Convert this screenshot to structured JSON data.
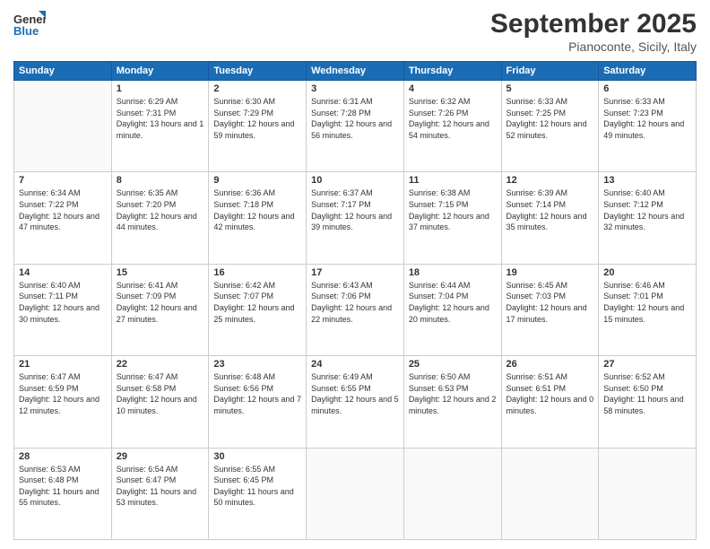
{
  "header": {
    "logo_line1": "General",
    "logo_line2": "Blue",
    "month_title": "September 2025",
    "location": "Pianoconte, Sicily, Italy"
  },
  "weekdays": [
    "Sunday",
    "Monday",
    "Tuesday",
    "Wednesday",
    "Thursday",
    "Friday",
    "Saturday"
  ],
  "weeks": [
    [
      {
        "day": "",
        "sunrise": "",
        "sunset": "",
        "daylight": ""
      },
      {
        "day": "1",
        "sunrise": "Sunrise: 6:29 AM",
        "sunset": "Sunset: 7:31 PM",
        "daylight": "Daylight: 13 hours and 1 minute."
      },
      {
        "day": "2",
        "sunrise": "Sunrise: 6:30 AM",
        "sunset": "Sunset: 7:29 PM",
        "daylight": "Daylight: 12 hours and 59 minutes."
      },
      {
        "day": "3",
        "sunrise": "Sunrise: 6:31 AM",
        "sunset": "Sunset: 7:28 PM",
        "daylight": "Daylight: 12 hours and 56 minutes."
      },
      {
        "day": "4",
        "sunrise": "Sunrise: 6:32 AM",
        "sunset": "Sunset: 7:26 PM",
        "daylight": "Daylight: 12 hours and 54 minutes."
      },
      {
        "day": "5",
        "sunrise": "Sunrise: 6:33 AM",
        "sunset": "Sunset: 7:25 PM",
        "daylight": "Daylight: 12 hours and 52 minutes."
      },
      {
        "day": "6",
        "sunrise": "Sunrise: 6:33 AM",
        "sunset": "Sunset: 7:23 PM",
        "daylight": "Daylight: 12 hours and 49 minutes."
      }
    ],
    [
      {
        "day": "7",
        "sunrise": "Sunrise: 6:34 AM",
        "sunset": "Sunset: 7:22 PM",
        "daylight": "Daylight: 12 hours and 47 minutes."
      },
      {
        "day": "8",
        "sunrise": "Sunrise: 6:35 AM",
        "sunset": "Sunset: 7:20 PM",
        "daylight": "Daylight: 12 hours and 44 minutes."
      },
      {
        "day": "9",
        "sunrise": "Sunrise: 6:36 AM",
        "sunset": "Sunset: 7:18 PM",
        "daylight": "Daylight: 12 hours and 42 minutes."
      },
      {
        "day": "10",
        "sunrise": "Sunrise: 6:37 AM",
        "sunset": "Sunset: 7:17 PM",
        "daylight": "Daylight: 12 hours and 39 minutes."
      },
      {
        "day": "11",
        "sunrise": "Sunrise: 6:38 AM",
        "sunset": "Sunset: 7:15 PM",
        "daylight": "Daylight: 12 hours and 37 minutes."
      },
      {
        "day": "12",
        "sunrise": "Sunrise: 6:39 AM",
        "sunset": "Sunset: 7:14 PM",
        "daylight": "Daylight: 12 hours and 35 minutes."
      },
      {
        "day": "13",
        "sunrise": "Sunrise: 6:40 AM",
        "sunset": "Sunset: 7:12 PM",
        "daylight": "Daylight: 12 hours and 32 minutes."
      }
    ],
    [
      {
        "day": "14",
        "sunrise": "Sunrise: 6:40 AM",
        "sunset": "Sunset: 7:11 PM",
        "daylight": "Daylight: 12 hours and 30 minutes."
      },
      {
        "day": "15",
        "sunrise": "Sunrise: 6:41 AM",
        "sunset": "Sunset: 7:09 PM",
        "daylight": "Daylight: 12 hours and 27 minutes."
      },
      {
        "day": "16",
        "sunrise": "Sunrise: 6:42 AM",
        "sunset": "Sunset: 7:07 PM",
        "daylight": "Daylight: 12 hours and 25 minutes."
      },
      {
        "day": "17",
        "sunrise": "Sunrise: 6:43 AM",
        "sunset": "Sunset: 7:06 PM",
        "daylight": "Daylight: 12 hours and 22 minutes."
      },
      {
        "day": "18",
        "sunrise": "Sunrise: 6:44 AM",
        "sunset": "Sunset: 7:04 PM",
        "daylight": "Daylight: 12 hours and 20 minutes."
      },
      {
        "day": "19",
        "sunrise": "Sunrise: 6:45 AM",
        "sunset": "Sunset: 7:03 PM",
        "daylight": "Daylight: 12 hours and 17 minutes."
      },
      {
        "day": "20",
        "sunrise": "Sunrise: 6:46 AM",
        "sunset": "Sunset: 7:01 PM",
        "daylight": "Daylight: 12 hours and 15 minutes."
      }
    ],
    [
      {
        "day": "21",
        "sunrise": "Sunrise: 6:47 AM",
        "sunset": "Sunset: 6:59 PM",
        "daylight": "Daylight: 12 hours and 12 minutes."
      },
      {
        "day": "22",
        "sunrise": "Sunrise: 6:47 AM",
        "sunset": "Sunset: 6:58 PM",
        "daylight": "Daylight: 12 hours and 10 minutes."
      },
      {
        "day": "23",
        "sunrise": "Sunrise: 6:48 AM",
        "sunset": "Sunset: 6:56 PM",
        "daylight": "Daylight: 12 hours and 7 minutes."
      },
      {
        "day": "24",
        "sunrise": "Sunrise: 6:49 AM",
        "sunset": "Sunset: 6:55 PM",
        "daylight": "Daylight: 12 hours and 5 minutes."
      },
      {
        "day": "25",
        "sunrise": "Sunrise: 6:50 AM",
        "sunset": "Sunset: 6:53 PM",
        "daylight": "Daylight: 12 hours and 2 minutes."
      },
      {
        "day": "26",
        "sunrise": "Sunrise: 6:51 AM",
        "sunset": "Sunset: 6:51 PM",
        "daylight": "Daylight: 12 hours and 0 minutes."
      },
      {
        "day": "27",
        "sunrise": "Sunrise: 6:52 AM",
        "sunset": "Sunset: 6:50 PM",
        "daylight": "Daylight: 11 hours and 58 minutes."
      }
    ],
    [
      {
        "day": "28",
        "sunrise": "Sunrise: 6:53 AM",
        "sunset": "Sunset: 6:48 PM",
        "daylight": "Daylight: 11 hours and 55 minutes."
      },
      {
        "day": "29",
        "sunrise": "Sunrise: 6:54 AM",
        "sunset": "Sunset: 6:47 PM",
        "daylight": "Daylight: 11 hours and 53 minutes."
      },
      {
        "day": "30",
        "sunrise": "Sunrise: 6:55 AM",
        "sunset": "Sunset: 6:45 PM",
        "daylight": "Daylight: 11 hours and 50 minutes."
      },
      {
        "day": "",
        "sunrise": "",
        "sunset": "",
        "daylight": ""
      },
      {
        "day": "",
        "sunrise": "",
        "sunset": "",
        "daylight": ""
      },
      {
        "day": "",
        "sunrise": "",
        "sunset": "",
        "daylight": ""
      },
      {
        "day": "",
        "sunrise": "",
        "sunset": "",
        "daylight": ""
      }
    ]
  ]
}
